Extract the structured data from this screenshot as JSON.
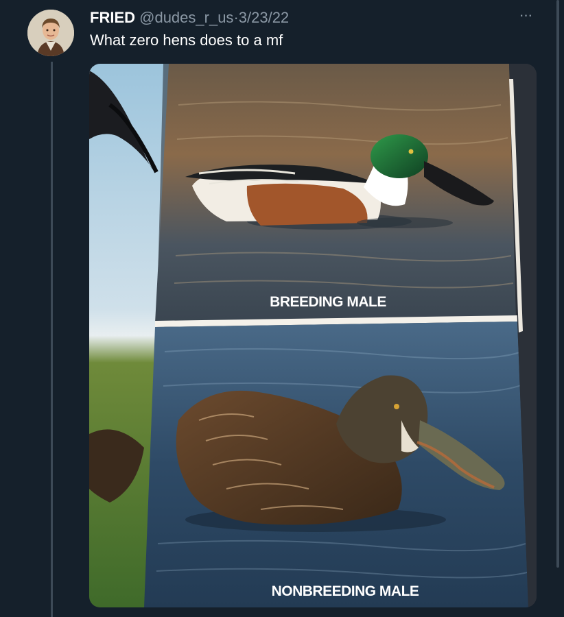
{
  "tweet": {
    "display_name": "FRIED",
    "handle": "@dudes_r_us",
    "separator": "·",
    "date": "3/23/22",
    "text": "What zero hens does to a mf",
    "more_label": "···"
  },
  "photo": {
    "caption_top": "BREEDING MALE",
    "caption_bottom": "NONBREEDING MALE"
  },
  "colors": {
    "background": "#15202b",
    "text_primary": "#ffffff",
    "text_secondary": "#8b98a5",
    "thread_line": "#3d4a57"
  },
  "icons": {
    "more": "more-options-icon"
  }
}
